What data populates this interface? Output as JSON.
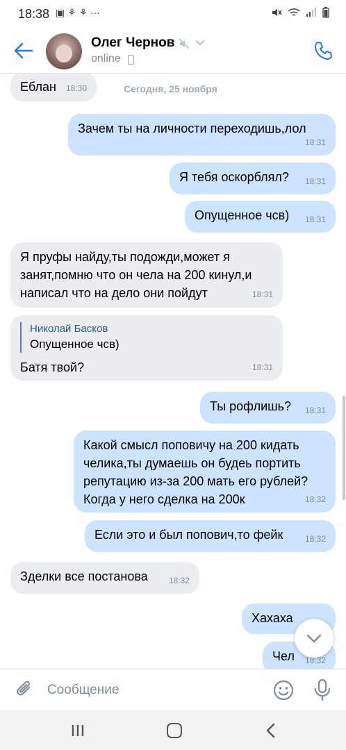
{
  "status_bar": {
    "time": "18:38",
    "left_icons": "▣ ⚘ ⚘ ···"
  },
  "header": {
    "name": "Олег Чернов",
    "status": "online"
  },
  "chat": {
    "date_separator": "Сегодня, 25 ноября",
    "messages": [
      {
        "dir": "in",
        "text": "Еблан",
        "time": "18:30"
      },
      {
        "dir": "out",
        "text": "Зачем ты на личности переходишь,лол",
        "time": "18:31"
      },
      {
        "dir": "out",
        "text": "Я тебя оскорблял?",
        "time": "18:31"
      },
      {
        "dir": "out",
        "text": "Опущенное чсв)",
        "time": "18:31"
      },
      {
        "dir": "in",
        "text": "Я пруфы найду,ты подожди,может я занят,помню что он чела на 200 кинул,и написал что на дело они пойдут",
        "time": "18:31"
      },
      {
        "dir": "in",
        "reply_name": "Николай Басков",
        "reply_text": "Опущенное чсв)",
        "text": "Батя твой?",
        "time": "18:31"
      },
      {
        "dir": "out",
        "text": "Ты рофлишь?",
        "time": "18:31"
      },
      {
        "dir": "out",
        "text": "Какой смысл поповичу на 200 кидать челика,ты думаешь он будеь портить репутацию из-за 200 мать его рублей? Когда у него сделка на 200к",
        "time": "18:32"
      },
      {
        "dir": "out",
        "text": "Если это и был попович,то фейк",
        "time": "18:32"
      },
      {
        "dir": "in",
        "text": "Зделки все постанова",
        "time": "18:32"
      },
      {
        "dir": "out",
        "text": "Хахаха",
        "time": ""
      },
      {
        "dir": "out",
        "text": "Чел",
        "time": "18:32"
      }
    ]
  },
  "composer": {
    "placeholder": "Сообщение"
  },
  "colors": {
    "accent": "#2a79d4",
    "incoming_bubble": "#ebedf0",
    "outgoing_bubble": "#cce4ff"
  }
}
